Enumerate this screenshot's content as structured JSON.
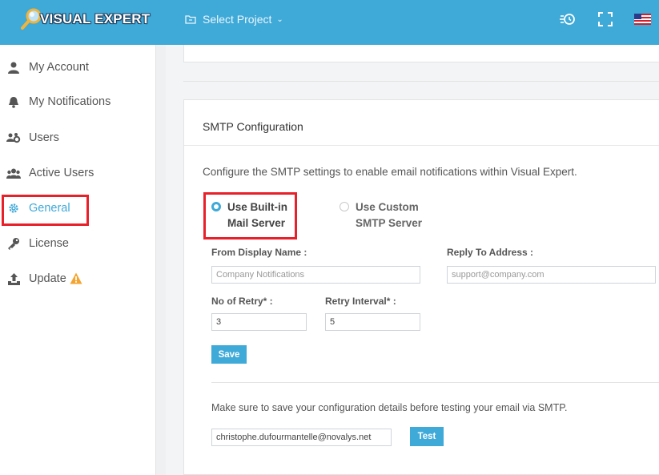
{
  "header": {
    "logo_text": "VISUAL EXPERT",
    "project_select_label": "Select Project"
  },
  "sidebar": {
    "items": [
      {
        "label": "My Account",
        "icon": "user-icon"
      },
      {
        "label": "My Notifications",
        "icon": "bell-icon"
      },
      {
        "label": "Users",
        "icon": "users-gear-icon"
      },
      {
        "label": "Active Users",
        "icon": "users-icon"
      },
      {
        "label": "General",
        "icon": "gear-icon",
        "active": true
      },
      {
        "label": "License",
        "icon": "key-icon"
      },
      {
        "label": "Update",
        "icon": "upload-icon",
        "badge_icon": "warning-icon"
      }
    ]
  },
  "smtp": {
    "title": "SMTP Configuration",
    "description": "Configure the SMTP settings to enable email notifications within Visual Expert.",
    "options": [
      {
        "line1": "Use Built-in",
        "line2": "Mail Server",
        "selected": true
      },
      {
        "line1": "Use Custom",
        "line2": "SMTP Server",
        "selected": false
      }
    ],
    "from_display_name_label": "From Display Name :",
    "from_display_name_placeholder": "Company Notifications",
    "reply_to_label": "Reply To Address :",
    "reply_to_placeholder": "support@company.com",
    "retry_label": "No of Retry* :",
    "retry_value": "3",
    "retry_interval_label": "Retry Interval* :",
    "retry_interval_value": "5",
    "save_label": "Save",
    "test_note": "Make sure to save your configuration details before testing your email via SMTP.",
    "test_email_value": "christophe.dufourmantelle@novalys.net",
    "test_label": "Test"
  },
  "colors": {
    "header_bg": "#3fa9d8",
    "accent": "#3fa9d8",
    "highlight": "#e8202a",
    "warning": "#f4a531"
  }
}
